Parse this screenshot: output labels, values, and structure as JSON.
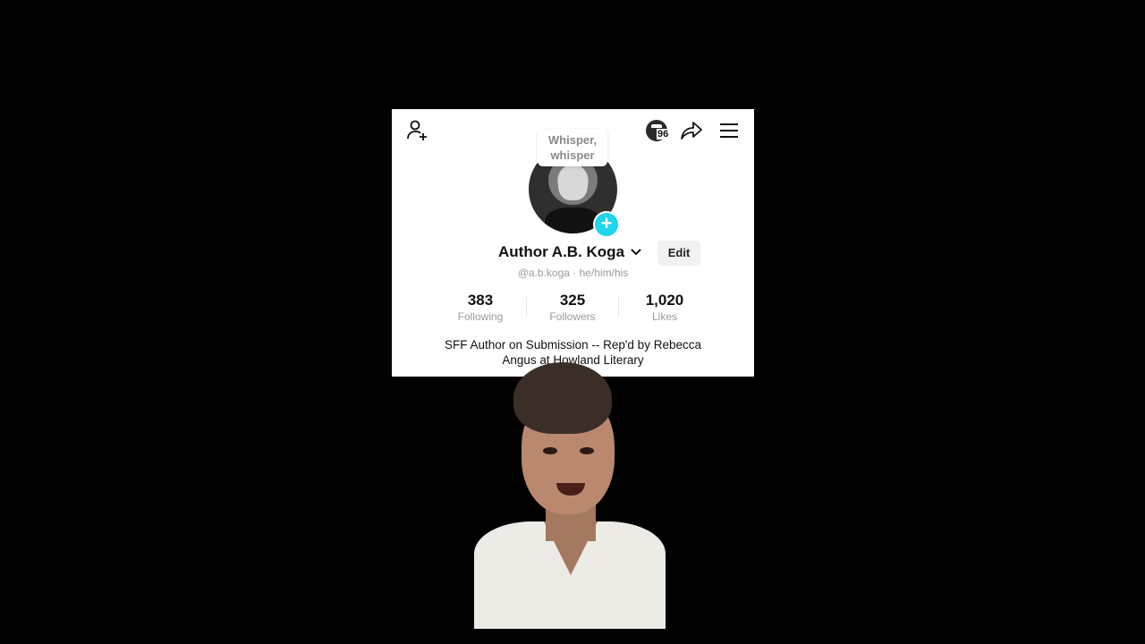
{
  "header": {
    "add_user_icon": "person-add-icon",
    "badge_count": "96",
    "share_icon": "share-arrow-icon",
    "menu_icon": "hamburger-menu-icon"
  },
  "tooltip": {
    "text": "Whisper, whisper"
  },
  "profile": {
    "name": "Author A.B. Koga",
    "edit_label": "Edit",
    "handle": "@a.b.koga · he/him/his",
    "stats": [
      {
        "value": "383",
        "label": "Following"
      },
      {
        "value": "325",
        "label": "Followers"
      },
      {
        "value": "1,020",
        "label": "Likes"
      }
    ],
    "bio": "SFF Author on Submission -- Rep'd by Rebecca Angus at Howland Literary"
  },
  "colors": {
    "accent": "#20d5ec",
    "muted": "#9a9a9a"
  }
}
